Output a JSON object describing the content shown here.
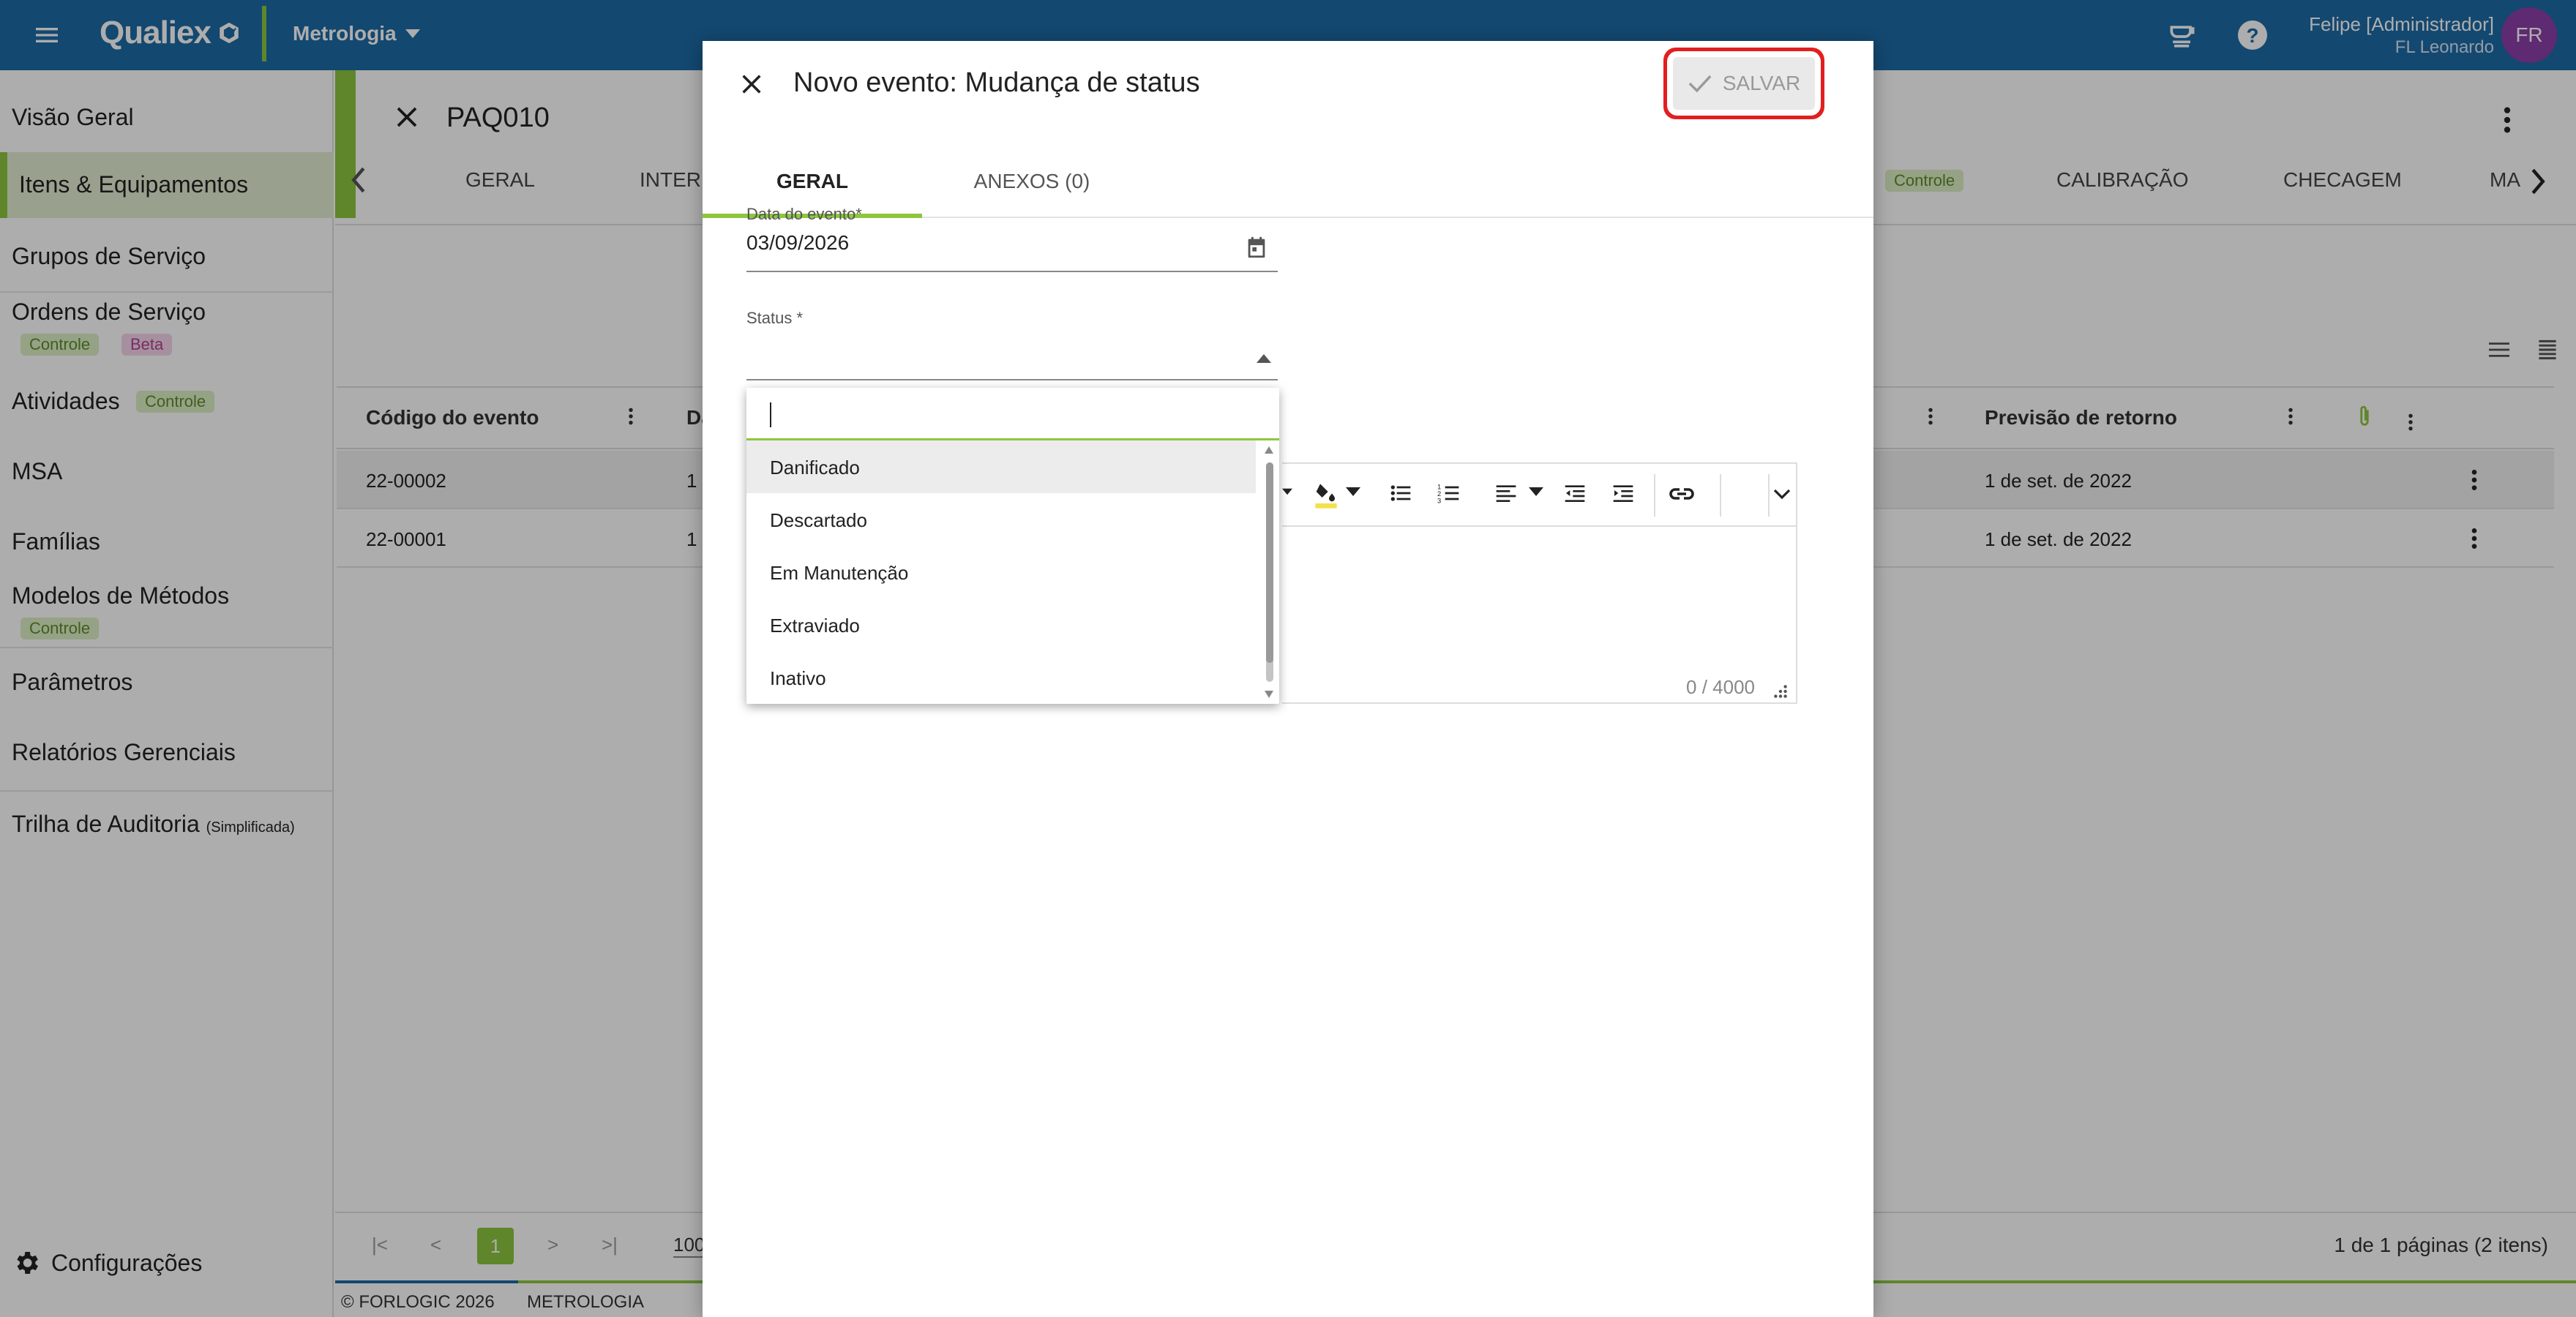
{
  "topbar": {
    "app_name": "Qualiex",
    "module": "Metrologia",
    "user_name": "Felipe [Administrador]",
    "user_org": "FL Leonardo",
    "avatar_initials": "FR",
    "color": "#1d6aa5"
  },
  "sidebar": {
    "items": [
      {
        "label": "Visão Geral"
      },
      {
        "label": "Itens & Equipamentos",
        "active": true
      },
      {
        "label": "Grupos de Serviço"
      },
      {
        "label": "Ordens de Serviço",
        "badges": [
          "Controle",
          "Beta"
        ]
      },
      {
        "label": "Atividades",
        "badges": [
          "Controle"
        ]
      },
      {
        "label": "MSA"
      },
      {
        "label": "Famílias"
      },
      {
        "label": "Modelos de Métodos",
        "badges": [
          "Controle"
        ]
      },
      {
        "label": "Parâmetros"
      },
      {
        "label": "Relatórios Gerenciais"
      },
      {
        "label": "Trilha de Auditoria",
        "sub": "(Simplificada)"
      }
    ],
    "settings": "Configurações"
  },
  "main": {
    "code": "PAQ010",
    "tabs": [
      "GERAL",
      "INTER",
      "Controle",
      "CALIBRAÇÃO",
      "CHECAGEM",
      "MA"
    ],
    "columns": [
      "Código do evento",
      "Da",
      "Previsão de retorno"
    ],
    "rows": [
      {
        "code": "22-00002",
        "d": "1",
        "ret": "1 de set. de 2022"
      },
      {
        "code": "22-00001",
        "d": "1",
        "ret": "1 de set. de 2022"
      }
    ],
    "pager": {
      "current": "1",
      "size": "100",
      "info": "1 de 1 páginas (2 itens)"
    }
  },
  "footer": {
    "copyright": "© FORLOGIC 2026",
    "module": "METROLOGIA"
  },
  "modal": {
    "title": "Novo evento: Mudança de status",
    "save_label": "SALVAR",
    "tabs": [
      "GERAL",
      "ANEXOS (0)"
    ],
    "date_label": "Data do evento*",
    "date_value": "03/09/2026",
    "status_label": "Status *",
    "counter": "0 / 4000"
  },
  "dropdown": {
    "options": [
      "Danificado",
      "Descartado",
      "Em Manutenção",
      "Extraviado",
      "Inativo"
    ]
  },
  "colors": {
    "accent": "#8dc63f",
    "brand": "#1d6aa5",
    "highlight": "#e21f1f"
  }
}
